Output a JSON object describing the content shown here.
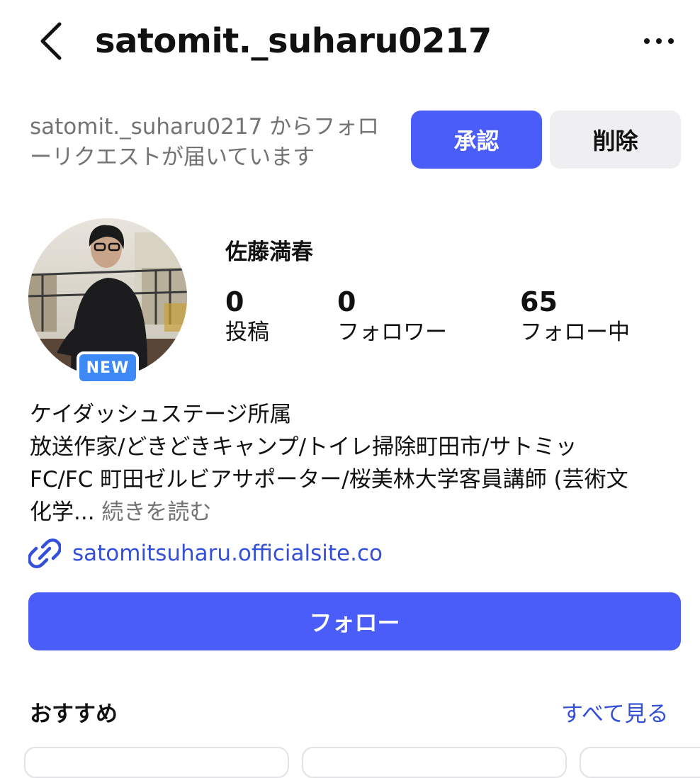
{
  "header": {
    "username": "satomit._suharu0217"
  },
  "follow_request": {
    "text": "satomit._suharu0217 からフォローリクエストが届いています",
    "approve_label": "承認",
    "delete_label": "削除"
  },
  "profile": {
    "new_badge": "NEW",
    "display_name": "佐藤満春",
    "stats": {
      "posts": {
        "count": "0",
        "label": "投稿"
      },
      "followers": {
        "count": "0",
        "label": "フォロワー"
      },
      "following": {
        "count": "65",
        "label": "フォロー中"
      }
    },
    "bio_lines": [
      "ケイダッシュステージ所属",
      "放送作家/どきどきキャンプ/トイレ掃除町田市/サトミッ",
      "FC/FC 町田ゼルビアサポーター/桜美林大学客員講師 (芸術文",
      "化学..."
    ],
    "bio_more": "続きを読む",
    "link": "satomitsuharu.officialsite.co"
  },
  "actions": {
    "follow_label": "フォロー"
  },
  "suggestions": {
    "title": "おすすめ",
    "see_all": "すべて見る"
  },
  "colors": {
    "accent": "#4a5df9",
    "link": "#3550d8",
    "badge": "#3d8af7",
    "muted": "#737373"
  },
  "icons": {
    "back": "chevron-left-icon",
    "more": "more-horizontal-icon",
    "link": "link-chain-icon"
  }
}
